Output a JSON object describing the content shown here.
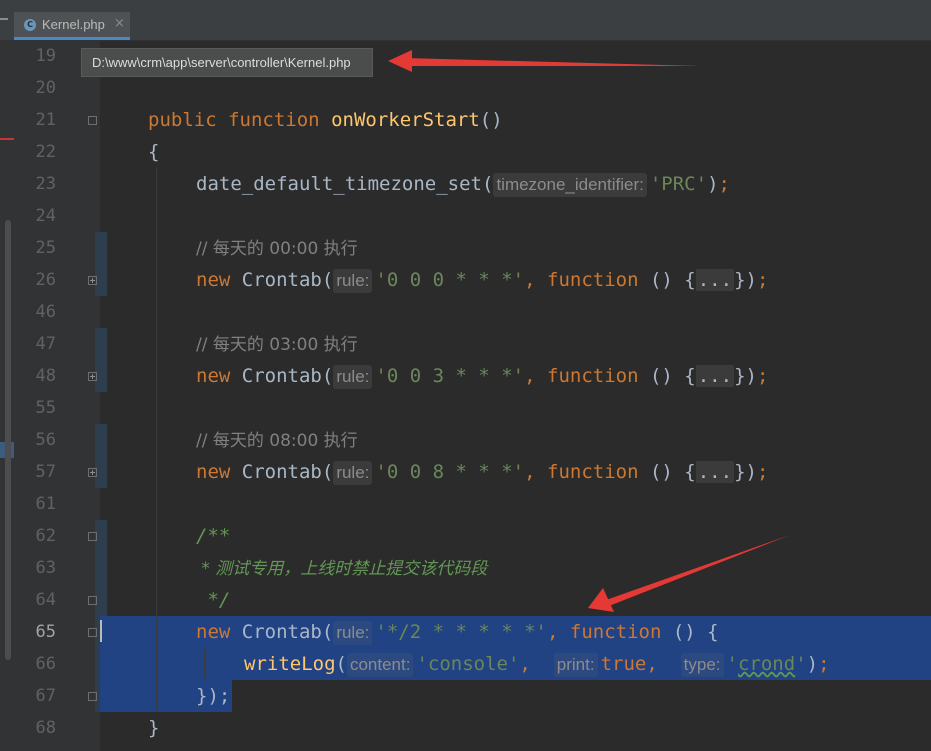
{
  "tab": {
    "file_icon_letter": "C",
    "file_name": "Kernel.php",
    "close_glyph": "×"
  },
  "tooltip": {
    "path": "D:\\www\\crm\\app\\server\\controller\\Kernel.php"
  },
  "editor": {
    "line_numbers": [
      "19",
      "20",
      "21",
      "22",
      "23",
      "24",
      "25",
      "26",
      "46",
      "47",
      "48",
      "55",
      "56",
      "57",
      "61",
      "62",
      "63",
      "64",
      "65",
      "66",
      "67",
      "68"
    ],
    "current_line": "65",
    "tokens": {
      "public": "public",
      "function": "function",
      "method_name": "onWorkerStart",
      "parens": "()",
      "open_brace": "{",
      "close_brace": "}",
      "tz_func": "date_default_timezone_set",
      "tz_hint": "timezone_identifier:",
      "tz_value": "'PRC'",
      "comment_1": "// 每天的 00:00 执行",
      "comment_2": "// 每天的 03:00 执行",
      "comment_3": "// 每天的 08:00 执行",
      "new": "new",
      "crontab": "Crontab",
      "rule_hint": "rule:",
      "rule_1": "'0 0 0 * * *'",
      "rule_2": "'0 0 3 * * *'",
      "rule_3": "'0 0 8 * * *'",
      "folded": "...",
      "doc_open": "/**",
      "doc_text": " * 测试专用，上线时禁止提交该代码段",
      "doc_close": " */",
      "rule_4": "'*/2 * * * * *'",
      "writelog": "writeLog",
      "content_hint": "content:",
      "content_value": "'console'",
      "print_hint": "print:",
      "print_value": "true",
      "type_hint": "type:",
      "type_value_open": "'",
      "type_value": "crond",
      "type_value_close": "'",
      "end_closure": "});"
    }
  },
  "colors": {
    "background": "#2b2b2b",
    "keyword": "#cc7832",
    "function_name": "#ffc66d",
    "string": "#6a8759",
    "selection": "#214283",
    "annotation_arrow": "#e53935"
  }
}
